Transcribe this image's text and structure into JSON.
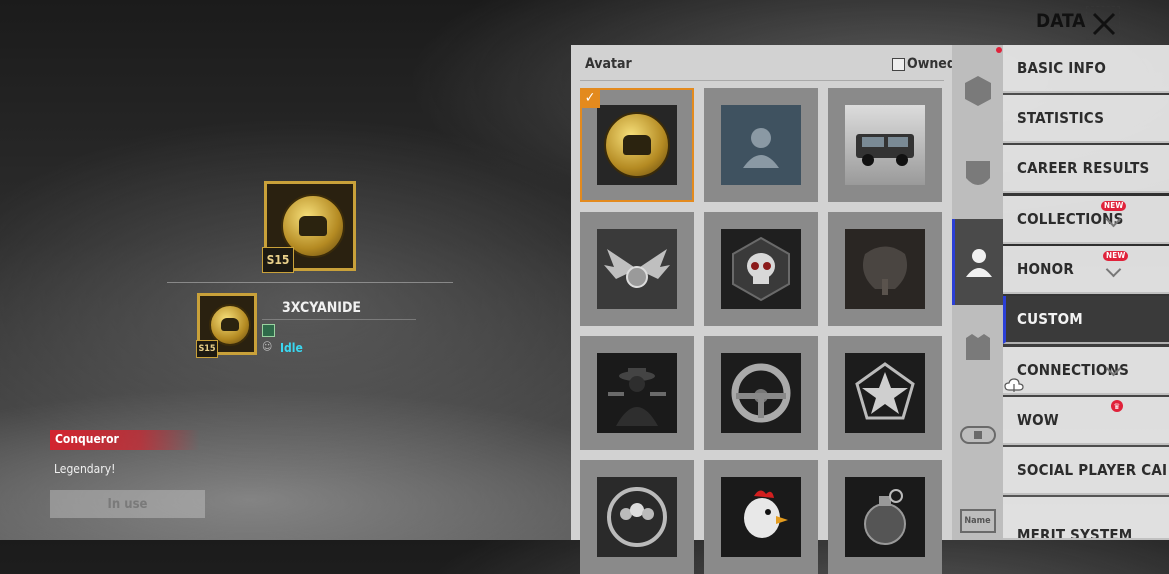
{
  "header": {
    "title": "DATA"
  },
  "profile": {
    "large_badge_season": "S15",
    "small_badge_season": "S15",
    "player_name": "3XCYANIDE",
    "status": "Idle"
  },
  "title_card": {
    "rank": "Conqueror",
    "subtitle": "Legendary!",
    "use_button": "In use"
  },
  "avatar_panel": {
    "title": "Avatar",
    "owned_label": "Owned",
    "tiles": [
      {
        "icon": "pubg-helmet-medal",
        "selected": true
      },
      {
        "icon": "default-person"
      },
      {
        "icon": "suv-car"
      },
      {
        "icon": "winged-emblem"
      },
      {
        "icon": "skull-emblem"
      },
      {
        "icon": "tree-emblem"
      },
      {
        "icon": "gunslinger"
      },
      {
        "icon": "steering-wheel"
      },
      {
        "icon": "star-medal"
      },
      {
        "icon": "team-crest"
      },
      {
        "icon": "rooster"
      },
      {
        "icon": "grenade"
      }
    ]
  },
  "icon_column": [
    {
      "icon": "hexagon-frame-icon"
    },
    {
      "icon": "shield-icon"
    },
    {
      "icon": "person-icon",
      "active": true
    },
    {
      "icon": "frame-icon"
    },
    {
      "icon": "nameplate-icon"
    },
    {
      "icon": "name-tag-icon",
      "label": "Name"
    }
  ],
  "menu": {
    "items": [
      {
        "label": "BASIC INFO"
      },
      {
        "label": "STATISTICS"
      },
      {
        "label": "CAREER RESULTS"
      },
      {
        "label": "COLLECTIONS",
        "badge": "NEW"
      },
      {
        "label": "HONOR",
        "badge": "NEW"
      },
      {
        "label": "CUSTOM"
      },
      {
        "label": "CONNECTIONS"
      },
      {
        "label": "WOW"
      },
      {
        "label": "SOCIAL PLAYER CAI"
      },
      {
        "label": "MERIT SYSTEM"
      }
    ]
  },
  "colors": {
    "accent_selected": "#e38a1e",
    "active_indicator": "#2b3fd6",
    "new_badge": "#e0223a",
    "rank_red": "#e0323a",
    "status_cyan": "#3ad7f0"
  }
}
